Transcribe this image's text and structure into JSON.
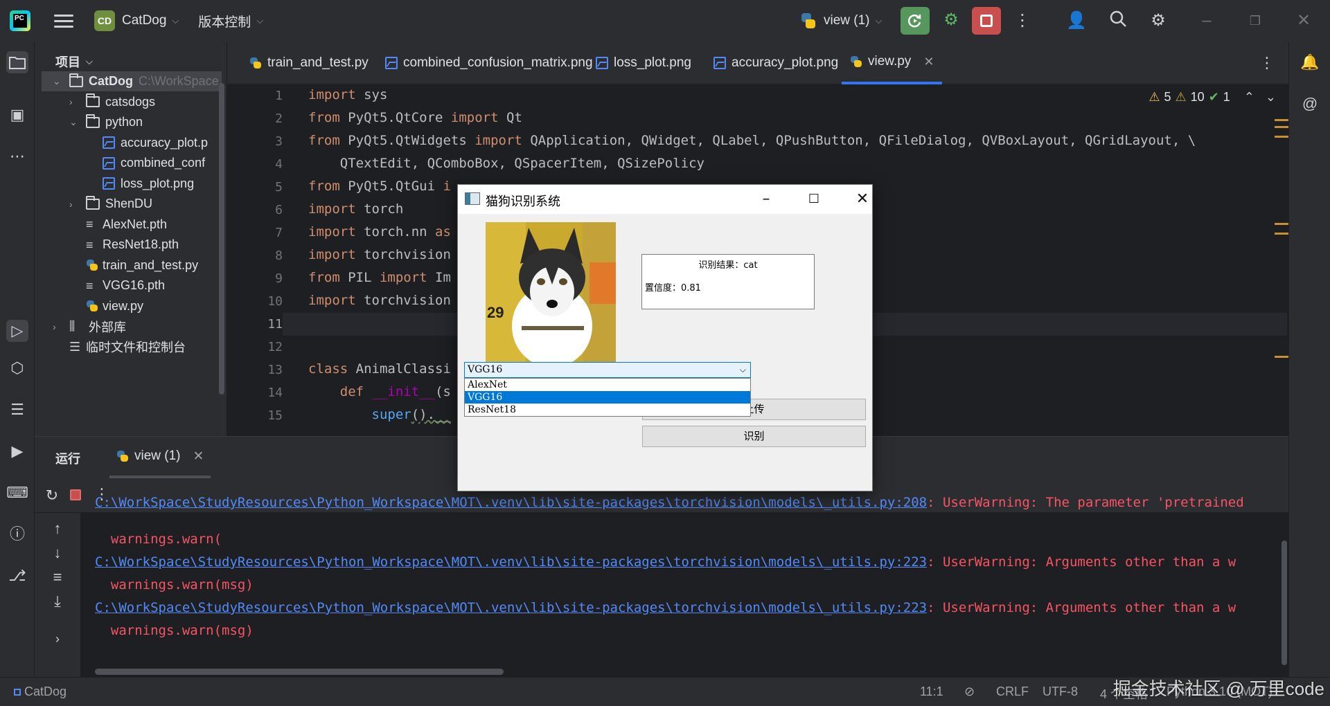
{
  "titlebar": {
    "project_badge": "CD",
    "project_name": "CatDog",
    "vcs_label": "版本控制",
    "run_config": "view (1)"
  },
  "project_panel": {
    "title": "项目",
    "tree": [
      {
        "label": "CatDog",
        "path": "C:\\WorkSpace",
        "type": "folder",
        "expanded": true,
        "selected": true
      },
      {
        "label": "catsdogs",
        "type": "folder",
        "expanded": false
      },
      {
        "label": "python",
        "type": "folder",
        "expanded": true
      },
      {
        "label": "accuracy_plot.p",
        "type": "image"
      },
      {
        "label": "combined_conf",
        "type": "image"
      },
      {
        "label": "loss_plot.png",
        "type": "image"
      },
      {
        "label": "ShenDU",
        "type": "folder",
        "expanded": false
      },
      {
        "label": "AlexNet.pth",
        "type": "text"
      },
      {
        "label": "ResNet18.pth",
        "type": "text"
      },
      {
        "label": "train_and_test.py",
        "type": "python"
      },
      {
        "label": "VGG16.pth",
        "type": "text"
      },
      {
        "label": "view.py",
        "type": "python"
      },
      {
        "label": "外部库",
        "type": "library"
      },
      {
        "label": "临时文件和控制台",
        "type": "scratch"
      }
    ]
  },
  "tabs": [
    {
      "label": "train_and_test.py",
      "icon": "python-file-icon"
    },
    {
      "label": "combined_confusion_matrix.png",
      "icon": "image-file-icon"
    },
    {
      "label": "loss_plot.png",
      "icon": "image-file-icon"
    },
    {
      "label": "accuracy_plot.png",
      "icon": "image-file-icon"
    },
    {
      "label": "view.py",
      "icon": "python-file-icon",
      "active": true
    }
  ],
  "inspections": {
    "warnings": "5",
    "weak_warnings": "10",
    "ok": "1"
  },
  "editor": {
    "line_numbers": [
      "1",
      "2",
      "3",
      "4",
      "5",
      "6",
      "7",
      "8",
      "9",
      "10",
      "11",
      "12",
      "13",
      "14",
      "15"
    ],
    "lines": [
      [
        {
          "t": "import",
          "c": "kw"
        },
        {
          "t": " sys",
          "c": ""
        }
      ],
      [
        {
          "t": "from",
          "c": "kw"
        },
        {
          "t": " PyQt5.QtCore ",
          "c": ""
        },
        {
          "t": "import",
          "c": "kw"
        },
        {
          "t": " Qt",
          "c": ""
        }
      ],
      [
        {
          "t": "from",
          "c": "kw"
        },
        {
          "t": " PyQt5.QtWidgets ",
          "c": ""
        },
        {
          "t": "import",
          "c": "kw"
        },
        {
          "t": " QApplication, QWidget, QLabel, QPushButton, QFileDialog, QVBoxLayout, QGridLayout, \\",
          "c": ""
        }
      ],
      [
        {
          "t": "    QTextEdit, QComboBox, QSpacerItem, QSizePolicy",
          "c": ""
        }
      ],
      [
        {
          "t": "from",
          "c": "kw"
        },
        {
          "t": " PyQt5.QtGui ",
          "c": ""
        },
        {
          "t": "i",
          "c": "kw"
        }
      ],
      [
        {
          "t": "import",
          "c": "kw"
        },
        {
          "t": " torch",
          "c": ""
        }
      ],
      [
        {
          "t": "import",
          "c": "kw"
        },
        {
          "t": " torch.nn ",
          "c": ""
        },
        {
          "t": "as",
          "c": "kw"
        }
      ],
      [
        {
          "t": "import",
          "c": "kw"
        },
        {
          "t": " torchvision",
          "c": ""
        }
      ],
      [
        {
          "t": "from",
          "c": "kw"
        },
        {
          "t": " PIL ",
          "c": ""
        },
        {
          "t": "import",
          "c": "kw"
        },
        {
          "t": " Im",
          "c": ""
        }
      ],
      [
        {
          "t": "import",
          "c": "kw"
        },
        {
          "t": " torchvision",
          "c": ""
        }
      ],
      [],
      [],
      [
        {
          "t": "class",
          "c": "kw"
        },
        {
          "t": " AnimalClassi",
          "c": ""
        }
      ],
      [
        {
          "t": "    ",
          "c": ""
        },
        {
          "t": "def",
          "c": "kw"
        },
        {
          "t": " ",
          "c": ""
        },
        {
          "t": "__init__",
          "c": "magic"
        },
        {
          "t": "(s",
          "c": ""
        }
      ],
      [
        {
          "t": "        ",
          "c": ""
        },
        {
          "t": "super",
          "c": "fn"
        },
        {
          "t": "().__",
          "c": ""
        }
      ]
    ]
  },
  "run_panel": {
    "title": "运行",
    "tab_label": "view (1)",
    "output": [
      {
        "link": "C:\\WorkSpace\\StudyResources\\Python_Workspace\\MOT\\.venv\\lib\\site-packages\\torchvision\\models\\_utils.py:208",
        "msg": ": UserWarning: The parameter 'pretrained"
      },
      {
        "text": "  warnings.warn("
      },
      {
        "link": "C:\\WorkSpace\\StudyResources\\Python_Workspace\\MOT\\.venv\\lib\\site-packages\\torchvision\\models\\_utils.py:223",
        "msg": ": UserWarning: Arguments other than a w"
      },
      {
        "text": "  warnings.warn(msg)"
      },
      {
        "link": "C:\\WorkSpace\\StudyResources\\Python_Workspace\\MOT\\.venv\\lib\\site-packages\\torchvision\\models\\_utils.py:223",
        "msg": ": UserWarning: Arguments other than a w"
      },
      {
        "text": "  warnings.warn(msg)"
      }
    ]
  },
  "statusbar": {
    "project": "CatDog",
    "position": "11:1",
    "line_sep": "CRLF",
    "encoding": "UTF-8",
    "indent": "4 个空格",
    "interpreter": "Python 3.10 (MOT)"
  },
  "qt_window": {
    "title": "猫狗识别系统",
    "result_label": "识别结果：cat",
    "confidence_label": "置信度：0.81",
    "combo_value": "VGG16",
    "options": [
      "AlexNet",
      "VGG16",
      "ResNet18"
    ],
    "selected_option": "VGG16",
    "upload_button": "上传",
    "recognize_button": "识别"
  },
  "watermark": "掘金技术社区 @ 万里code"
}
